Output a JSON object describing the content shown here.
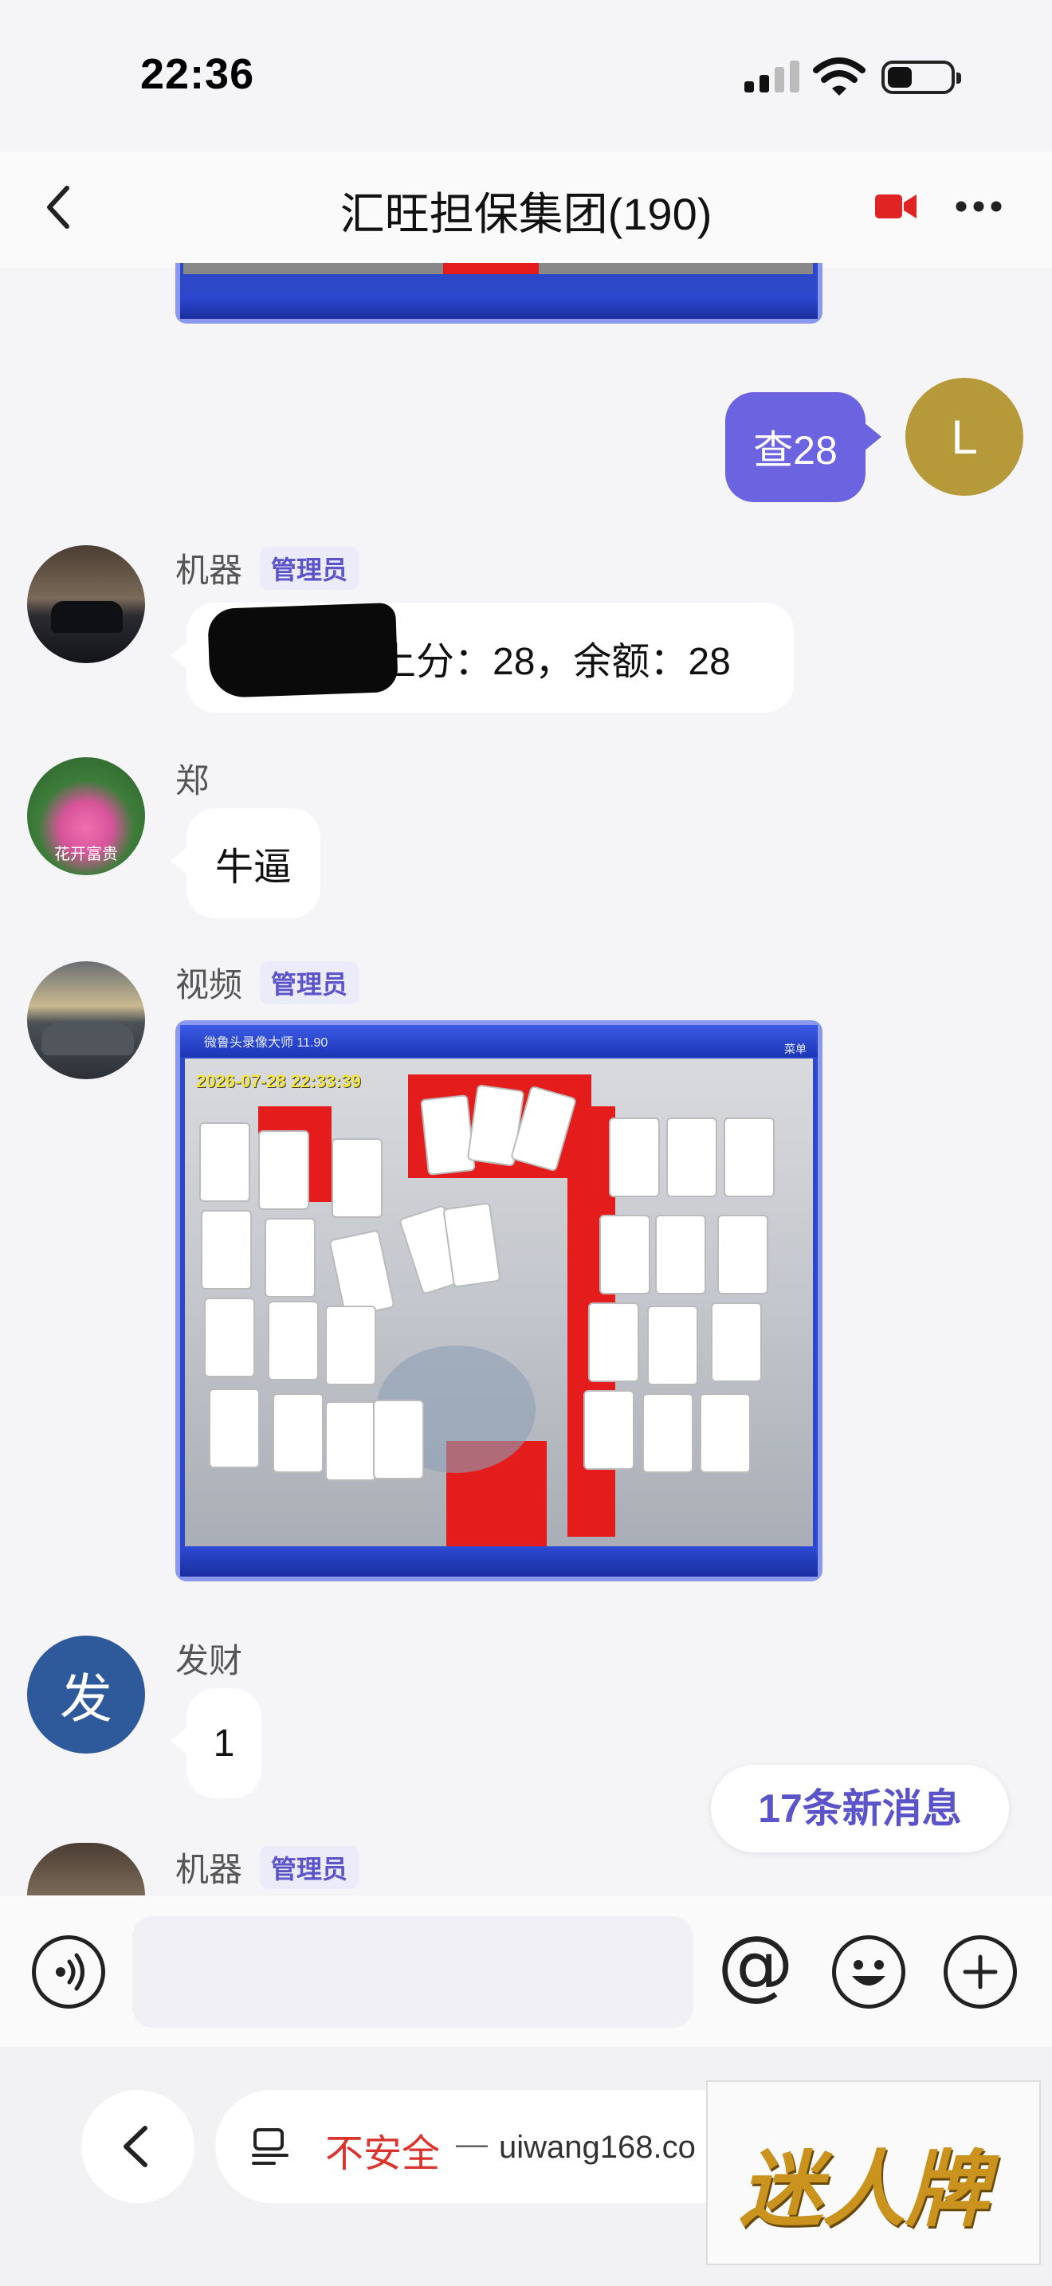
{
  "status_bar": {
    "time": "22:36"
  },
  "header": {
    "title": "汇旺担保集团(190)",
    "back_icon": "chevron-left-icon",
    "video_icon": "video-camera-icon",
    "more_icon": "more-dots-icon",
    "video_icon_color": "#e02424"
  },
  "messages": {
    "self": {
      "text": "查28",
      "avatar_letter": "L",
      "bubble_color": "#6b63e0",
      "avatar_color": "#b69a3a"
    },
    "robot1": {
      "name": "机器",
      "badge": "管理员",
      "text": "上分：28，余额：28"
    },
    "zheng": {
      "name": "郑",
      "text": "牛逼",
      "avatar_caption": "花开富贵"
    },
    "video": {
      "name": "视频",
      "badge": "管理员",
      "capture_title": "微鲁头录像大师  11.90",
      "capture_menu": "菜单",
      "capture_timestamp": "2026-07-28 22:33:39"
    },
    "facai": {
      "name": "发财",
      "text": "1",
      "avatar_char": "发",
      "avatar_color": "#2e5a9c"
    },
    "robot2": {
      "name": "机器",
      "badge": "管理员"
    }
  },
  "new_messages": "17条新消息",
  "input_bar": {
    "voice_icon": "voice-icon",
    "at_icon": "at-sign-icon",
    "emoji_icon": "emoji-icon",
    "plus_icon": "plus-icon",
    "placeholder": ""
  },
  "browser": {
    "insecure_label": "不安全",
    "dash": "—",
    "url": "uiwang168.co",
    "watermark_text": "迷人牌"
  },
  "accent_color": "#5a54c8"
}
